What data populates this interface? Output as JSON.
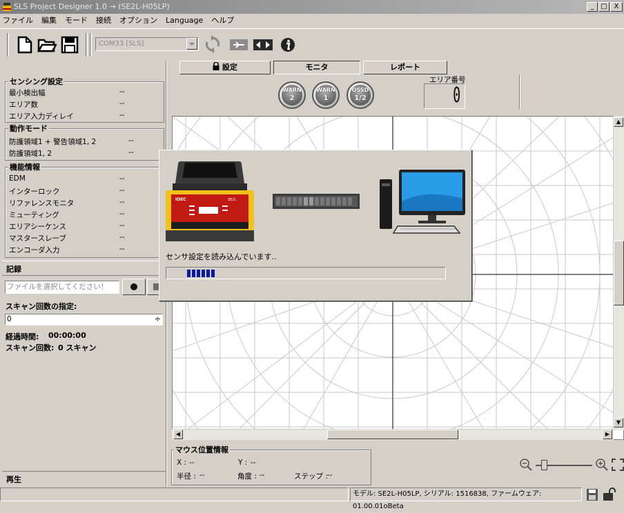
{
  "window": {
    "title": "SLS Project Designer 1.0 → (SE2L-H05LP)",
    "minimize": "_",
    "maximize": "□",
    "close": "X"
  },
  "menu": [
    "ファイル",
    "編集",
    "モード",
    "接続",
    "オプション",
    "Language",
    "ヘルプ"
  ],
  "toolbar": {
    "port": "COM33 [SLS]",
    "icons": [
      "new-file-icon",
      "open-folder-icon",
      "save-icon",
      "refresh-icon",
      "connect-icon",
      "transfer-icon",
      "info-icon"
    ]
  },
  "sensing": {
    "title": "センシング設定",
    "rows": [
      {
        "label": "最小検出幅",
        "value": "--"
      },
      {
        "label": "エリア数",
        "value": "--"
      },
      {
        "label": "エリア入力ディレイ",
        "value": "--"
      }
    ]
  },
  "mode": {
    "title": "動作モード",
    "rows": [
      {
        "label": "防護領域1 + 警告領域1, 2",
        "value": "--"
      },
      {
        "label": "防護領域1, 2",
        "value": "--"
      }
    ]
  },
  "features": {
    "title": "機能情報",
    "rows": [
      {
        "label": "EDM",
        "value": "--"
      },
      {
        "label": "インターロック",
        "value": "--"
      },
      {
        "label": "リファレンスモニタ",
        "value": "--"
      },
      {
        "label": "ミューティング",
        "value": "--"
      },
      {
        "label": "エリアシーケンス",
        "value": "--"
      },
      {
        "label": "マスタースレーブ",
        "value": "--"
      },
      {
        "label": "エンコーダ入力",
        "value": "--"
      }
    ]
  },
  "record": {
    "title": "記録",
    "file_placeholder": "ファイルを選択してください！",
    "scan_count_label": "スキャン回数の指定:",
    "scan_count_value": "0",
    "elapsed_label": "経過時間:",
    "elapsed_value": "00:00:00",
    "scans_label": "スキャン回数:",
    "scans_value": "0 スキャン"
  },
  "playback": {
    "title": "再生"
  },
  "tabs": {
    "settings": "設定",
    "monitor": "モニタ",
    "report": "レポート"
  },
  "indicators": [
    {
      "top": "WARN",
      "bottom": "2"
    },
    {
      "top": "WARN",
      "bottom": "1"
    },
    {
      "top": "OSSD",
      "bottom": "1/2"
    }
  ],
  "area_number": {
    "label": "エリア番号",
    "value": "0"
  },
  "dialog": {
    "message": "センサ設定を読み込んでいます..",
    "sensor_brand": "IDEC",
    "sensor_model": "SE2L",
    "progress_blocks": 6
  },
  "mouse_info": {
    "title": "マウス位置情報",
    "x_label": "X :",
    "x_value": "--",
    "y_label": "Y :",
    "y_value": "--",
    "radius_label": "半径 :",
    "radius_value": "--",
    "angle_label": "角度 :",
    "angle_value": "--",
    "step_label": "ステップ :",
    "step_value": "--"
  },
  "zoom": {
    "level": 0.15
  },
  "statusbar": {
    "info": "モデル: SE2L-H05LP, シリアル: 1516838, ファームウェア: 01.00.01oBeta"
  },
  "colors": {
    "window_bg": "#d4d0c8",
    "progress": "#0a1aa0",
    "monitor_blue": "#2a9be6",
    "sensor_yellow": "#f2c21b",
    "sensor_red": "#c21a12"
  }
}
